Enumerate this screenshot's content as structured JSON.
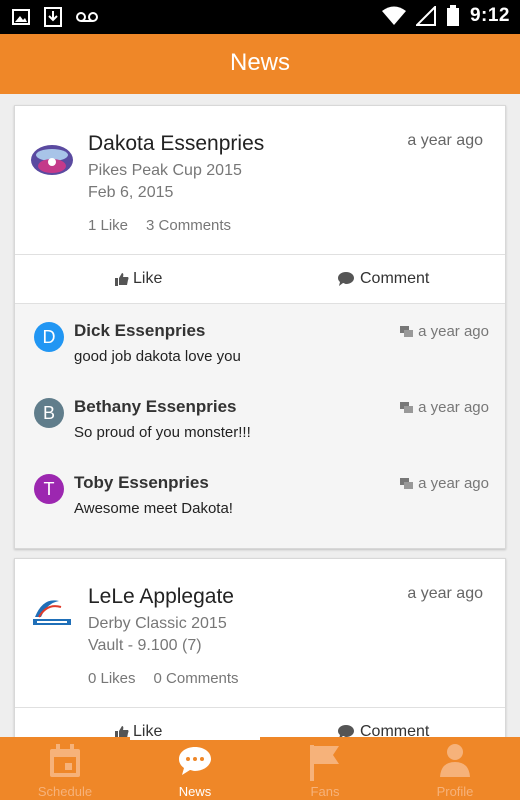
{
  "status_bar": {
    "time": "9:12"
  },
  "app_bar": {
    "title": "News"
  },
  "posts": [
    {
      "name": "Dakota Essenpries",
      "time": "a year ago",
      "line1": "Pikes Peak Cup 2015",
      "line2": "Feb 6, 2015",
      "likes": "1 Like",
      "comments_count": "3 Comments",
      "like_label": "Like",
      "comment_label": "Comment",
      "comments": [
        {
          "initial": "D",
          "name": "Dick Essenpries",
          "text": "good job dakota love you",
          "time": "a year ago",
          "color": "#2196f3"
        },
        {
          "initial": "B",
          "name": "Bethany Essenpries",
          "text": "So proud of you monster!!!",
          "time": "a year ago",
          "color": "#607d8b"
        },
        {
          "initial": "T",
          "name": "Toby Essenpries",
          "text": "Awesome meet Dakota!",
          "time": "a year ago",
          "color": "#9c27b0"
        }
      ]
    },
    {
      "name": "LeLe Applegate",
      "time": "a year ago",
      "line1": "Derby Classic 2015",
      "line2": "Vault - 9.100 (7)",
      "likes": "0 Likes",
      "comments_count": "0 Comments",
      "like_label": "Like",
      "comment_label": "Comment"
    }
  ],
  "bottom_nav": [
    {
      "label": "Schedule",
      "icon": "calendar-icon"
    },
    {
      "label": "News",
      "icon": "chat-bubble-icon",
      "active": true
    },
    {
      "label": "Fans",
      "icon": "flag-icon"
    },
    {
      "label": "Profile",
      "icon": "person-icon"
    }
  ],
  "colors": {
    "accent": "#ef8728"
  }
}
